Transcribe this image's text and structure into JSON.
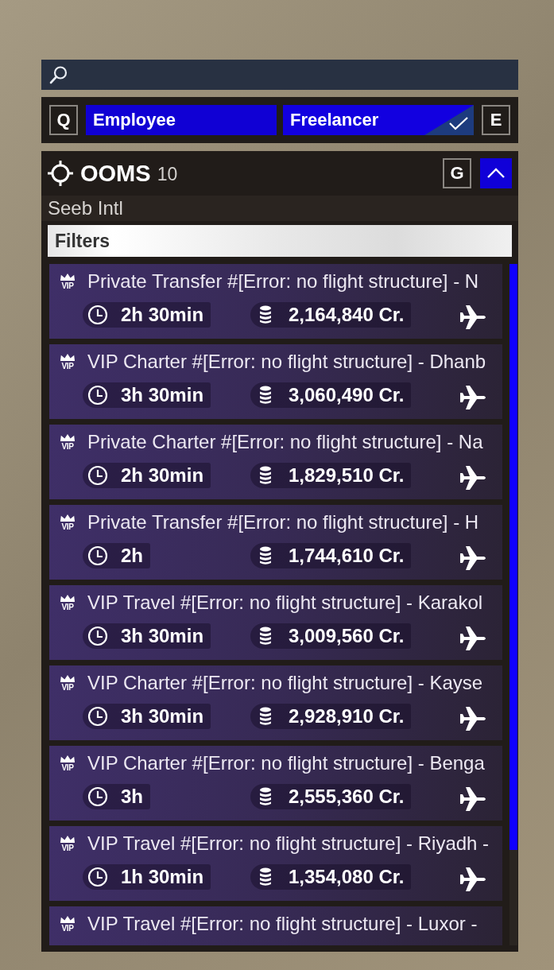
{
  "mode_tabs": {
    "prev_key": "Q",
    "next_key": "E",
    "tabs": [
      {
        "label": "Employee",
        "selected": false
      },
      {
        "label": "Freelancer",
        "selected": true
      }
    ]
  },
  "airport": {
    "code": "OOMS",
    "count": "10",
    "key": "G",
    "expanded": true,
    "name": "Seeb Intl"
  },
  "filters": {
    "label": "Filters"
  },
  "jobs": [
    {
      "badge": "VIP",
      "title": "Private Transfer #[Error: no flight structure] - N",
      "duration": "2h 30min",
      "price": "2,164,840 Cr."
    },
    {
      "badge": "VIP",
      "title": "VIP Charter #[Error: no flight structure] - Dhanb",
      "duration": "3h 30min",
      "price": "3,060,490 Cr."
    },
    {
      "badge": "VIP",
      "title": "Private Charter #[Error: no flight structure] - Na",
      "duration": "2h 30min",
      "price": "1,829,510 Cr."
    },
    {
      "badge": "VIP",
      "title": "Private Transfer #[Error: no flight structure] - H",
      "duration": "2h",
      "price": "1,744,610 Cr."
    },
    {
      "badge": "VIP",
      "title": "VIP Travel #[Error: no flight structure] - Karakol",
      "duration": "3h 30min",
      "price": "3,009,560 Cr."
    },
    {
      "badge": "VIP",
      "title": "VIP Charter #[Error: no flight structure] - Kayse",
      "duration": "3h 30min",
      "price": "2,928,910 Cr."
    },
    {
      "badge": "VIP",
      "title": "VIP Charter #[Error: no flight structure] - Benga",
      "duration": "3h",
      "price": "2,555,360 Cr."
    },
    {
      "badge": "VIP",
      "title": "VIP Travel #[Error: no flight structure] - Riyadh -",
      "duration": "1h 30min",
      "price": "1,354,080 Cr."
    },
    {
      "badge": "VIP",
      "title": "VIP Travel #[Error: no flight structure] - Luxor -"
    }
  ]
}
